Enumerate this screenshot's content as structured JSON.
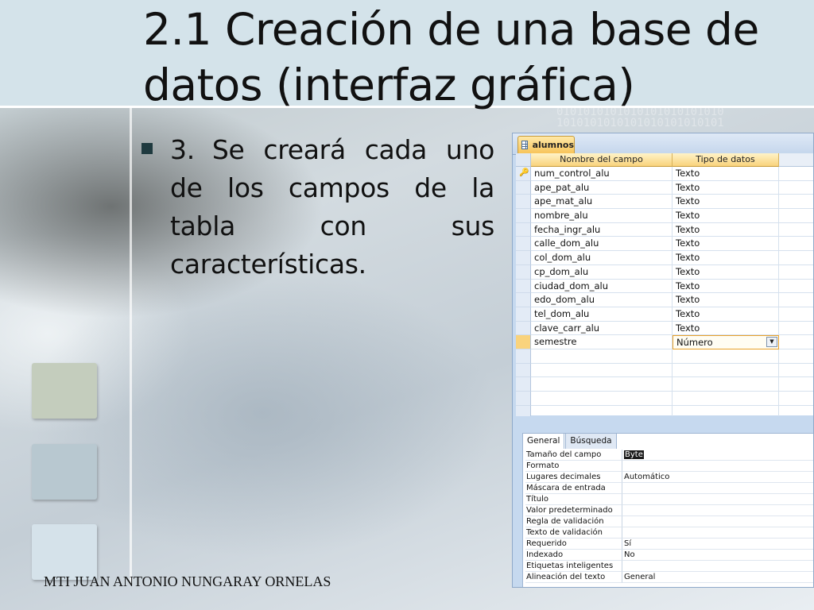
{
  "slide": {
    "title": "2.1 Creación de una base de datos (interfaz gráfica)",
    "bullet_number": "3.",
    "bullet_text": "Se creará cada uno de los campos de la tabla con sus características.",
    "footer": "MTI JUAN ANTONIO NUNGARAY ORNELAS"
  },
  "access": {
    "tab_label": "alumnos",
    "columns": [
      "Nombre del campo",
      "Tipo de datos"
    ],
    "fields": [
      {
        "name": "num_control_alu",
        "type": "Texto",
        "key": true
      },
      {
        "name": "ape_pat_alu",
        "type": "Texto"
      },
      {
        "name": "ape_mat_alu",
        "type": "Texto"
      },
      {
        "name": "nombre_alu",
        "type": "Texto"
      },
      {
        "name": "fecha_ingr_alu",
        "type": "Texto"
      },
      {
        "name": "calle_dom_alu",
        "type": "Texto"
      },
      {
        "name": "col_dom_alu",
        "type": "Texto"
      },
      {
        "name": "cp_dom_alu",
        "type": "Texto"
      },
      {
        "name": "ciudad_dom_alu",
        "type": "Texto"
      },
      {
        "name": "edo_dom_alu",
        "type": "Texto"
      },
      {
        "name": "tel_dom_alu",
        "type": "Texto"
      },
      {
        "name": "clave_carr_alu",
        "type": "Texto"
      },
      {
        "name": "semestre",
        "type": "Número",
        "active": true
      }
    ],
    "empty_rows": 5,
    "property_tabs": [
      "General",
      "Búsqueda"
    ],
    "properties": [
      {
        "label": "Tamaño del campo",
        "value": "Byte",
        "highlight": true
      },
      {
        "label": "Formato",
        "value": ""
      },
      {
        "label": "Lugares decimales",
        "value": "Automático"
      },
      {
        "label": "Máscara de entrada",
        "value": ""
      },
      {
        "label": "Título",
        "value": ""
      },
      {
        "label": "Valor predeterminado",
        "value": ""
      },
      {
        "label": "Regla de validación",
        "value": ""
      },
      {
        "label": "Texto de validación",
        "value": ""
      },
      {
        "label": "Requerido",
        "value": "Sí"
      },
      {
        "label": "Indexado",
        "value": "No"
      },
      {
        "label": "Etiquetas inteligentes",
        "value": ""
      },
      {
        "label": "Alineación del texto",
        "value": "General"
      }
    ]
  },
  "icons": {
    "bullet": "square-bullet-icon",
    "tab": "table-icon",
    "key": "primary-key-icon",
    "dropdown": "dropdown-arrow-icon"
  },
  "colors": {
    "title_band": "#d4e3ea",
    "header_cells": "#f9d37d",
    "access_frame": "#c6d9ef"
  }
}
